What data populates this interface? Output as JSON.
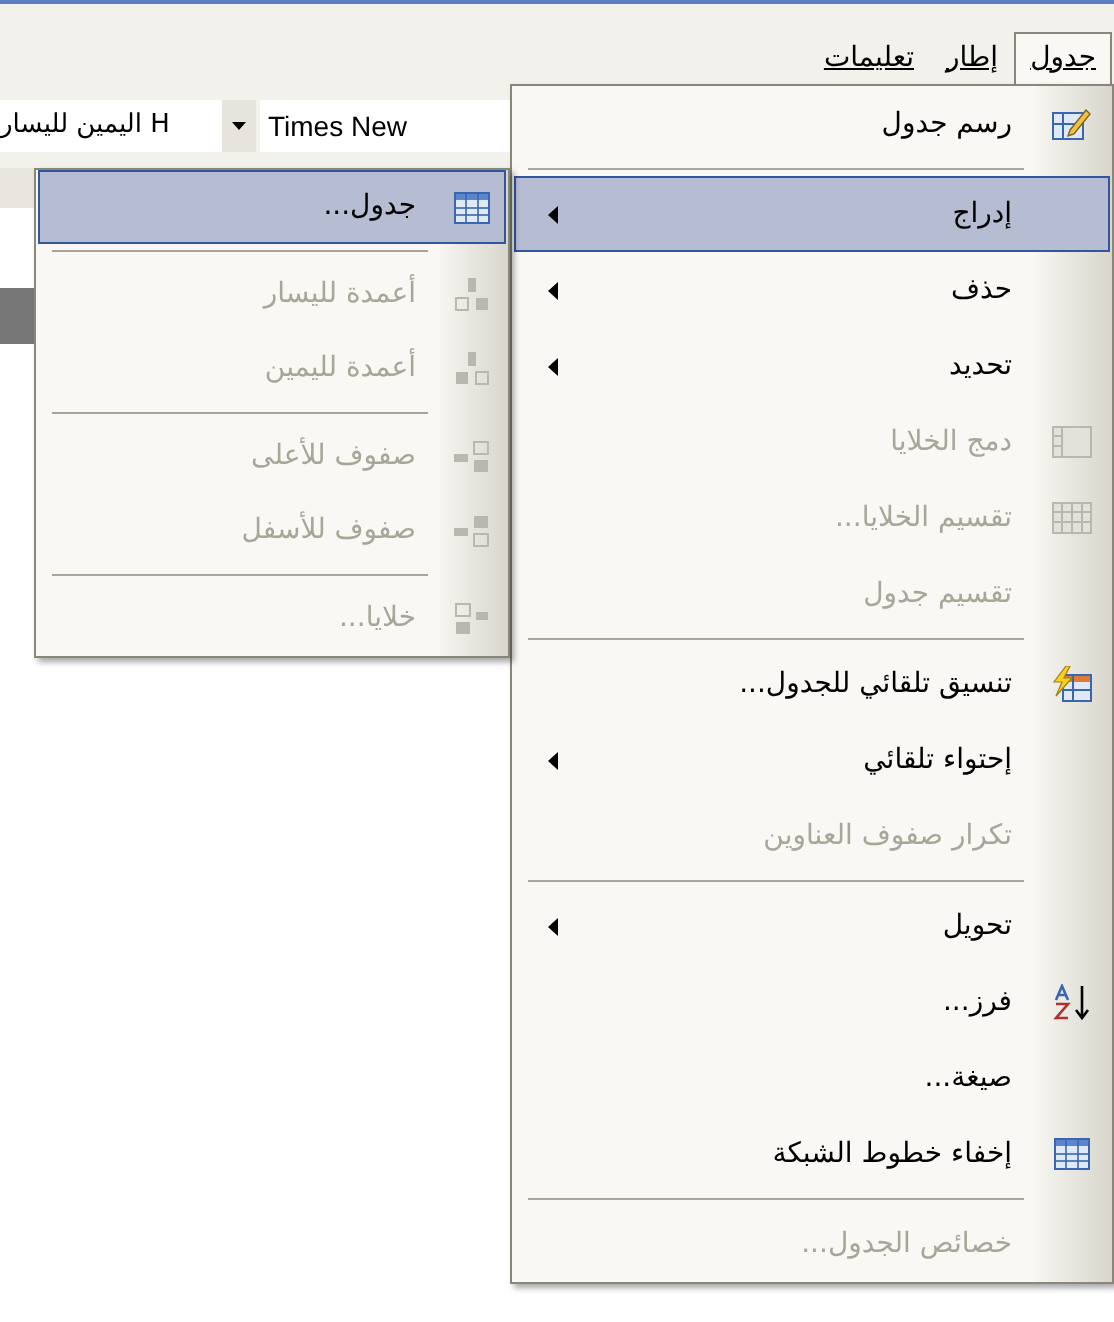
{
  "menu_bar": {
    "tabs": [
      {
        "label": "جدول",
        "selected": true
      },
      {
        "label": "إطار",
        "selected": false
      },
      {
        "label": "تعليمات",
        "selected": false
      }
    ]
  },
  "toolbar": {
    "style_box": "H اليمين لليسار",
    "font_box": "Times New"
  },
  "table_menu": {
    "items": [
      {
        "kind": "item",
        "label": "رسم جدول",
        "disabled": false,
        "submenu": false,
        "selected": false
      },
      {
        "kind": "separator"
      },
      {
        "kind": "item",
        "label": "إدراج",
        "disabled": false,
        "submenu": true,
        "selected": true
      },
      {
        "kind": "item",
        "label": "حذف",
        "disabled": false,
        "submenu": true,
        "selected": false
      },
      {
        "kind": "item",
        "label": "تحديد",
        "disabled": false,
        "submenu": true,
        "selected": false
      },
      {
        "kind": "item",
        "label": "دمج الخلايا",
        "disabled": true,
        "submenu": false,
        "selected": false
      },
      {
        "kind": "item",
        "label": "تقسيم الخلايا...",
        "disabled": true,
        "submenu": false,
        "selected": false
      },
      {
        "kind": "item",
        "label": "تقسيم جدول",
        "disabled": true,
        "submenu": false,
        "selected": false
      },
      {
        "kind": "separator"
      },
      {
        "kind": "item",
        "label": "تنسيق تلقائي للجدول...",
        "disabled": false,
        "submenu": false,
        "selected": false
      },
      {
        "kind": "item",
        "label": "إحتواء تلقائي",
        "disabled": false,
        "submenu": true,
        "selected": false
      },
      {
        "kind": "item",
        "label": "تكرار صفوف العناوين",
        "disabled": true,
        "submenu": false,
        "selected": false
      },
      {
        "kind": "separator"
      },
      {
        "kind": "item",
        "label": "تحويل",
        "disabled": false,
        "submenu": true,
        "selected": false
      },
      {
        "kind": "item",
        "label": "فرز...",
        "disabled": false,
        "submenu": false,
        "selected": false
      },
      {
        "kind": "item",
        "label": "صيغة...",
        "disabled": false,
        "submenu": false,
        "selected": false
      },
      {
        "kind": "item",
        "label": "إخفاء خطوط الشبكة",
        "disabled": false,
        "submenu": false,
        "selected": false
      },
      {
        "kind": "separator"
      },
      {
        "kind": "item",
        "label": "خصائص الجدول...",
        "disabled": true,
        "submenu": false,
        "selected": false
      }
    ]
  },
  "insert_submenu": {
    "items": [
      {
        "kind": "item",
        "label": "جدول...",
        "disabled": false,
        "selected": true
      },
      {
        "kind": "separator"
      },
      {
        "kind": "item",
        "label": "أعمدة لليسار",
        "disabled": true,
        "selected": false
      },
      {
        "kind": "item",
        "label": "أعمدة لليمين",
        "disabled": true,
        "selected": false
      },
      {
        "kind": "separator"
      },
      {
        "kind": "item",
        "label": "صفوف للأعلى",
        "disabled": true,
        "selected": false
      },
      {
        "kind": "item",
        "label": "صفوف للأسفل",
        "disabled": true,
        "selected": false
      },
      {
        "kind": "separator"
      },
      {
        "kind": "item",
        "label": "خلايا...",
        "disabled": true,
        "selected": false
      }
    ]
  }
}
